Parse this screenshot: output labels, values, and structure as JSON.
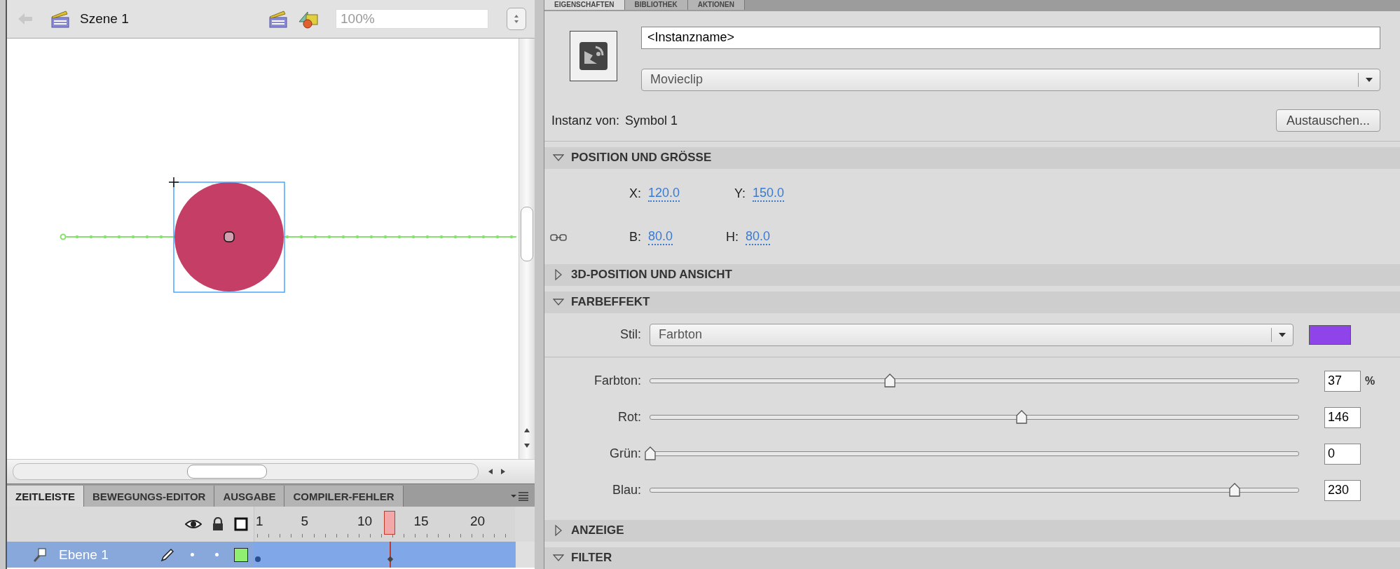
{
  "stage_toolbar": {
    "scene": "Szene 1",
    "zoom": "100%"
  },
  "panel_tabs": [
    {
      "label": "ZEITLEISTE",
      "selected": true
    },
    {
      "label": "BEWEGUNGS-EDITOR",
      "selected": false
    },
    {
      "label": "AUSGABE",
      "selected": false
    },
    {
      "label": "COMPILER-FEHLER",
      "selected": false
    }
  ],
  "timeline": {
    "frame_labels": [
      "1",
      "5",
      "10",
      "15",
      "20"
    ],
    "playhead": {
      "level": 0.52
    },
    "layers": [
      {
        "name": "Ebene 1",
        "selected": true
      }
    ]
  },
  "properties": {
    "tabs": [
      {
        "label": "EIGENSCHAFTEN",
        "selected": true
      },
      {
        "label": "BIBLIOTHEK",
        "selected": false
      },
      {
        "label": "AKTIONEN",
        "selected": false
      }
    ],
    "instance_name": "<Instanzname>",
    "symbol_type": "Movieclip",
    "instance_of_label": "Instanz von:",
    "instance_of": "Symbol 1",
    "swap_button": "Austauschen...",
    "sections": [
      {
        "kind": "position",
        "title": "POSITION UND GRÖSSE",
        "expanded": true,
        "rows": [
          [
            {
              "label": "X:",
              "value": "120.0"
            },
            {
              "label": "Y:",
              "value": "150.0"
            }
          ],
          [
            {
              "label": "B:",
              "value": "80.0"
            },
            {
              "label": "H:",
              "value": "80.0"
            }
          ]
        ]
      },
      {
        "kind": "plain",
        "title": "3D-POSITION UND ANSICHT",
        "expanded": false
      },
      {
        "kind": "color",
        "title": "FARBEFFEKT",
        "expanded": true,
        "style_label": "Stil:",
        "style": "Farbton",
        "color": "#8e44e8",
        "sliders": [
          {
            "label": "Farbton:",
            "level": 0.37,
            "value": "37",
            "unit": "%"
          },
          {
            "label": "Rot:",
            "level": 0.573,
            "value": "146"
          },
          {
            "label": "Grün:",
            "level": 0,
            "value": "0"
          },
          {
            "label": "Blau:",
            "level": 0.902,
            "value": "230"
          }
        ]
      },
      {
        "kind": "plain",
        "title": "ANZEIGE",
        "expanded": false
      },
      {
        "kind": "plain",
        "title": "FILTER",
        "expanded": true
      }
    ]
  }
}
